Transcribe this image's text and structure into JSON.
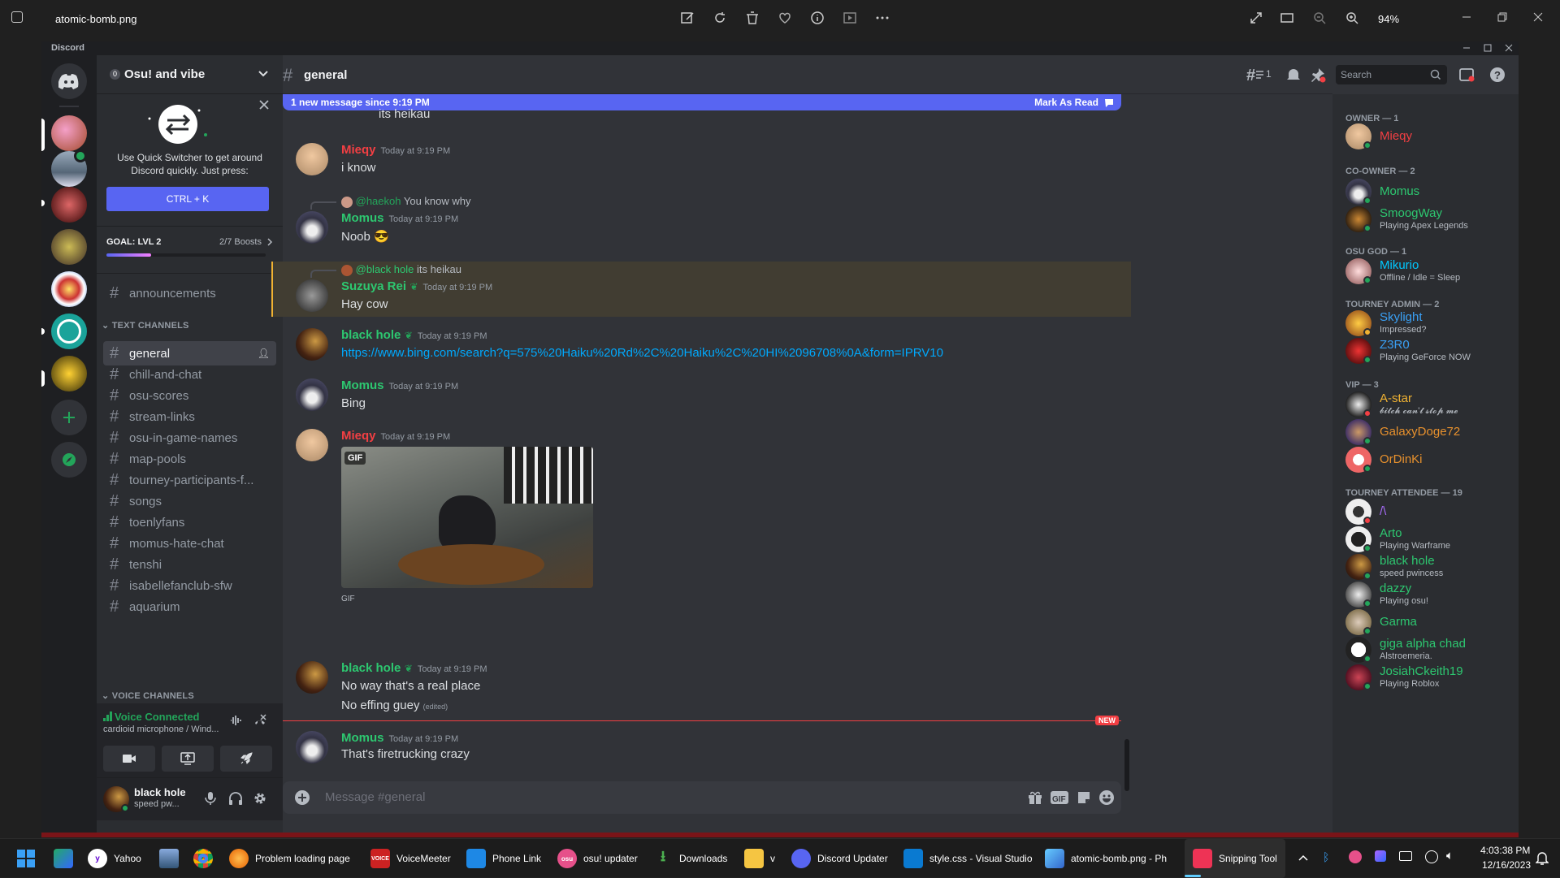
{
  "viewer": {
    "file_name": "atomic-bomb.png",
    "zoom": "94%"
  },
  "app": {
    "brand": "Discord"
  },
  "server": {
    "name": "Osu! and vibe",
    "boost_badge": "0"
  },
  "quick_switcher": {
    "text": "Use Quick Switcher to get around Discord quickly. Just press:",
    "button": "CTRL + K"
  },
  "goal": {
    "label": "GOAL: LVL 2",
    "boosts": "2/7 Boosts",
    "progress": 0.28
  },
  "channels": {
    "top": "announcements",
    "text_category": "TEXT CHANNELS",
    "voice_category": "VOICE CHANNELS",
    "list": [
      "general",
      "chill-and-chat",
      "osu-scores",
      "stream-links",
      "osu-in-game-names",
      "map-pools",
      "tourney-participants-f...",
      "songs",
      "toenlyfans",
      "momus-hate-chat",
      "tenshi",
      "isabellefanclub-sfw",
      "aquarium"
    ]
  },
  "voice": {
    "status": "Voice Connected",
    "device": "cardioid microphone / Wind..."
  },
  "user": {
    "name": "black hole",
    "status": "speed pw..."
  },
  "header": {
    "channel": "general",
    "threads_count": "1",
    "search_placeholder": "Search"
  },
  "banner": {
    "text": "1 new message since 9:19 PM",
    "action": "Mark As Read"
  },
  "messages": {
    "m0": {
      "text": "its heikau"
    },
    "m1": {
      "author": "Mieqy",
      "time": "Today at 9:19 PM",
      "text": "i know"
    },
    "m2": {
      "reply_author": "@haekoh",
      "reply_text": "You know why",
      "author": "Momus",
      "time": "Today at 9:19 PM",
      "text": "Noob",
      "emoji": "😎"
    },
    "m3": {
      "reply_author": "@black hole",
      "reply_text": "its heikau",
      "author": "Suzuya Rei",
      "time": "Today at 9:19 PM",
      "text": "Hay cow"
    },
    "m4": {
      "author": "black hole",
      "time": "Today at 9:19 PM",
      "link": "https://www.bing.com/search?q=575%20Haiku%20Rd%2C%20Haiku%2C%20HI%2096708%0A&form=IPRV10"
    },
    "m5": {
      "author": "Momus",
      "time": "Today at 9:19 PM",
      "text": "Bing"
    },
    "m6": {
      "author": "Mieqy",
      "time": "Today at 9:19 PM",
      "gif_badge": "GIF",
      "gif_caption": "GIF"
    },
    "m7": {
      "author": "black hole",
      "time": "Today at 9:19 PM",
      "text": "No way that's a real place",
      "text2": "No effing guey",
      "edited": "(edited)"
    },
    "new_label": "NEW",
    "m8": {
      "author": "Momus",
      "time": "Today at 9:19 PM",
      "text": "That's firetrucking crazy"
    }
  },
  "composer": {
    "placeholder": "Message #general"
  },
  "members": {
    "owner": "OWNER — 1",
    "coowner": "CO-OWNER — 2",
    "osugod": "OSU GOD — 1",
    "admin": "TOURNEY ADMIN — 2",
    "vip": "VIP — 3",
    "attendee": "TOURNEY ATTENDEE — 19",
    "list": [
      {
        "name": "Mieqy",
        "status": ""
      },
      {
        "name": "Momus",
        "status": ""
      },
      {
        "name": "SmoogWay",
        "status": "Playing Apex Legends"
      },
      {
        "name": "Mikurio",
        "status": "Offline / Idle = Sleep"
      },
      {
        "name": "Skylight",
        "status": "Impressed?"
      },
      {
        "name": "Z3R0",
        "status": "Playing GeForce NOW"
      },
      {
        "name": "A-star",
        "status": "𝓫𝓲𝓽𝓬𝓱 𝓬𝓪𝓷'𝓽 𝓼𝓽𝓸𝓹 𝓶𝓮"
      },
      {
        "name": "GalaxyDoge72",
        "status": ""
      },
      {
        "name": "OrDinKi",
        "status": ""
      },
      {
        "name": "/\\",
        "status": ""
      },
      {
        "name": "Arto",
        "status": "Playing Warframe"
      },
      {
        "name": "black hole",
        "status": "speed pwincess"
      },
      {
        "name": "dazzy",
        "status": "Playing osu!"
      },
      {
        "name": "Garma",
        "status": ""
      },
      {
        "name": "giga alpha chad",
        "status": "Alstroemeria."
      },
      {
        "name": "JosiahCkeith19",
        "status": "Playing Roblox"
      }
    ]
  },
  "taskbar": {
    "items": [
      "Yahoo",
      "Problem loading page",
      "VoiceMeeter",
      "Phone Link",
      "osu! updater",
      "Downloads",
      "v",
      "Discord Updater",
      "style.css - Visual Studio",
      "atomic-bomb.png - Ph",
      "Snipping Tool"
    ],
    "time": "4:03:38 PM",
    "date": "12/16/2023"
  },
  "colors": {
    "blurple": "#5865f2",
    "green": "#23a55a",
    "link": "#00a8fc",
    "mention": "#f23f43"
  }
}
